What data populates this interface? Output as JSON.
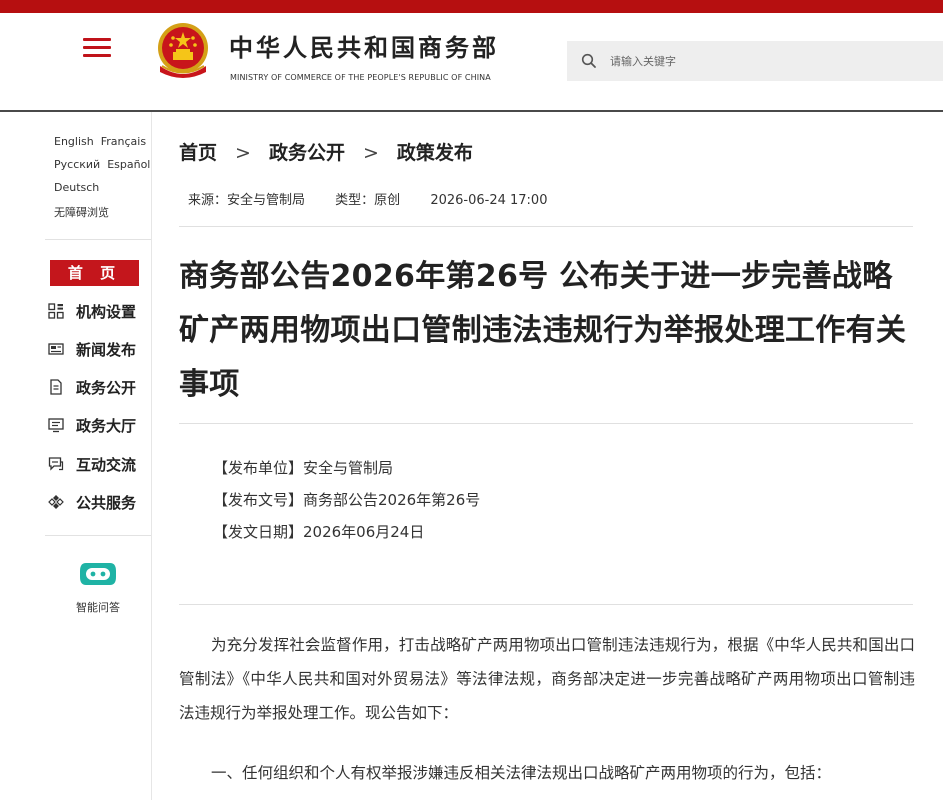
{
  "header": {
    "site_title": "中华人民共和国商务部",
    "site_subtitle": "MINISTRY OF COMMERCE OF THE PEOPLE'S REPUBLIC OF CHINA",
    "search_placeholder": "请输入关键字",
    "brand_color": "#c4161c"
  },
  "sidebar": {
    "languages": [
      "English",
      "Français",
      "Русский",
      "Español",
      "Deutsch",
      "无障碍浏览"
    ],
    "home_label": "首 页",
    "nav": [
      {
        "label": "机构设置",
        "icon": "grid-icon"
      },
      {
        "label": "新闻发布",
        "icon": "newspaper-icon"
      },
      {
        "label": "政务公开",
        "icon": "document-icon"
      },
      {
        "label": "政务大厅",
        "icon": "screen-icon"
      },
      {
        "label": "互动交流",
        "icon": "chat-icon"
      },
      {
        "label": "公共服务",
        "icon": "service-icon"
      }
    ],
    "assistant_label": "智能问答"
  },
  "breadcrumb": {
    "items": [
      "首页",
      "政务公开",
      "政策发布"
    ],
    "separator": ">"
  },
  "meta": {
    "source": "来源：安全与管制局",
    "type": "类型：原创",
    "datetime": "2026-06-24 17:00"
  },
  "article": {
    "title": "商务部公告2026年第26号 公布关于进一步完善战略矿产两用物项出口管制违法违规行为举报处理工作有关事项",
    "info": [
      "【发布单位】安全与管制局",
      "【发布文号】商务部公告2026年第26号",
      "【发文日期】2026年06月24日"
    ],
    "paragraph1": "为充分发挥社会监督作用，打击战略矿产两用物项出口管制违法违规行为，根据《中华人民共和国出口管制法》《中华人民共和国对外贸易法》等法律法规，商务部决定进一步完善战略矿产两用物项出口管制违法违规行为举报处理工作。现公告如下：",
    "paragraph2": "一、任何组织和个人有权举报涉嫌违反相关法律法规出口战略矿产两用物项的行为，包括："
  }
}
